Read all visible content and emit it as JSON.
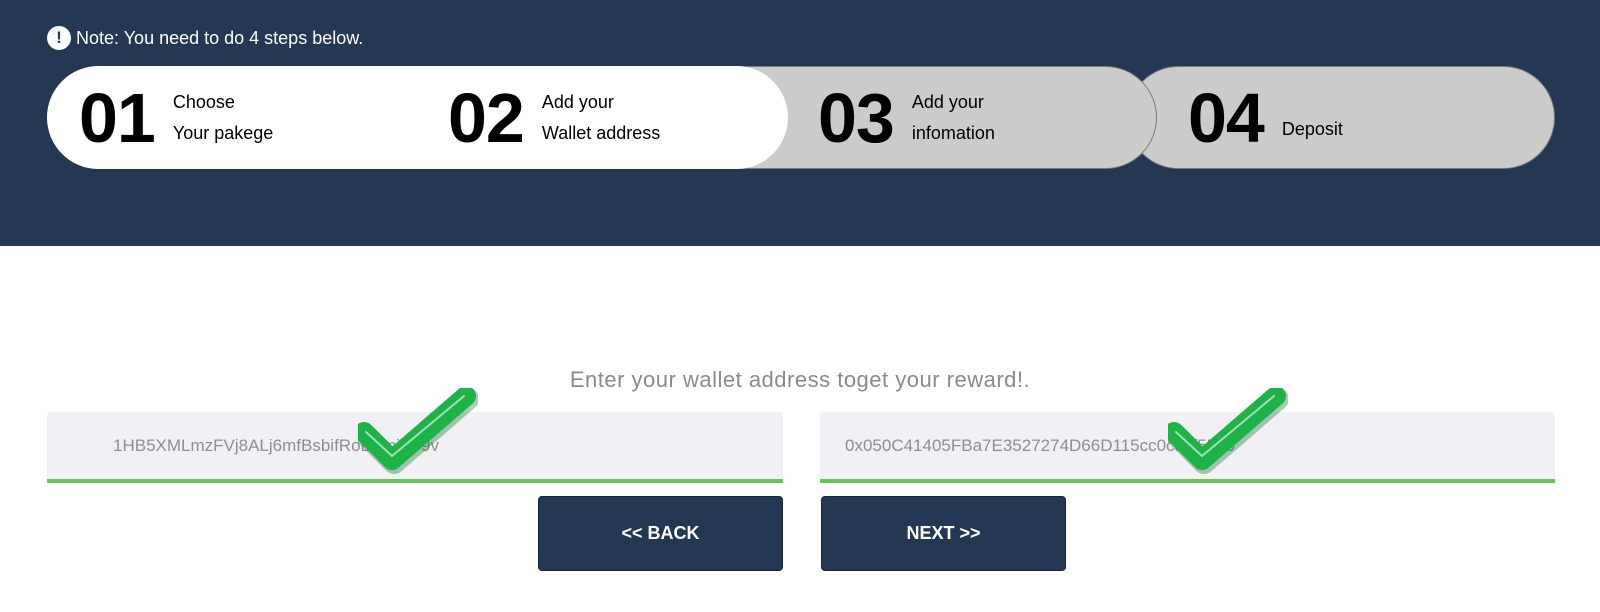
{
  "note": {
    "icon": "exclamation-circle-icon",
    "text": "Note: You need to do 4 steps below."
  },
  "steps": [
    {
      "number": "01",
      "line1": "Choose",
      "line2": "Your pakege",
      "state": "completed"
    },
    {
      "number": "02",
      "line1": "Add your",
      "line2": "Wallet address",
      "state": "current"
    },
    {
      "number": "03",
      "line1": "Add your",
      "line2": "infomation",
      "state": "pending"
    },
    {
      "number": "04",
      "line1": "Deposit",
      "line2": "",
      "state": "pending"
    }
  ],
  "form": {
    "prompt": "Enter your wallet address toget your reward!.",
    "field1_value": "1HB5XMLmzFVj8ALj6mfBsbifRoD4miY99v",
    "field2_value": "0x050C41405FBa7E3527274D66D115cc0cc6f5589",
    "valid_icon": "checkmark-icon"
  },
  "buttons": {
    "back": "<< BACK",
    "next": "NEXT >>"
  },
  "colors": {
    "banner": "#243853",
    "step_inactive": "#cbcbcb",
    "valid_underline": "#6ac259",
    "checkmark": "#1db349"
  }
}
